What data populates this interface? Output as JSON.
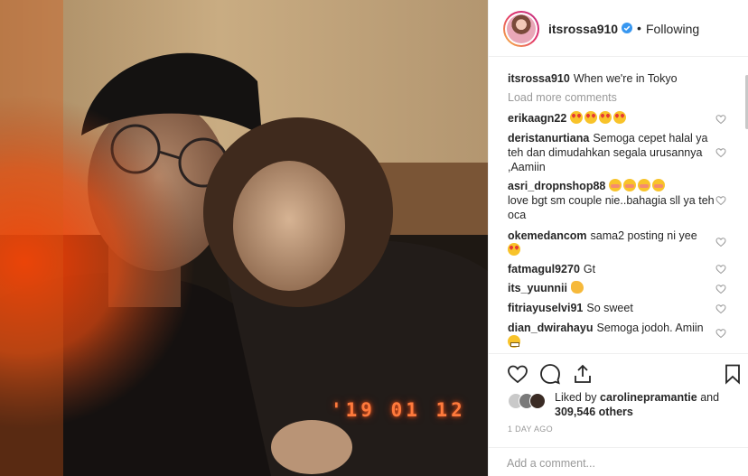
{
  "post": {
    "username": "itsrossa910",
    "follow_status": "Following",
    "separator": "•",
    "caption_user": "itsrossa910",
    "caption_text": "When we're in Tokyo",
    "photo_date_stamp": "'19 01 12"
  },
  "comments_panel": {
    "load_more_label": "Load more comments",
    "items": [
      {
        "user": "erikaagn22",
        "text": "",
        "emojis": [
          "heart-eyes",
          "heart-eyes",
          "heart-eyes",
          "heart-eyes"
        ]
      },
      {
        "user": "deristanurtiana",
        "text": "Semoga cepet halal ya teh dan dimudahkan segala urusannya ,Aamiin",
        "emojis": []
      },
      {
        "user": "asri_dropnshop88",
        "text": "love bgt sm couple nie..bahagia sll ya teh oca",
        "emojis": [
          "flushed",
          "flushed",
          "flushed",
          "flushed"
        ]
      },
      {
        "user": "okemedancom",
        "text": "sama2 posting ni yee",
        "emojis": [
          "heart-eyes"
        ]
      },
      {
        "user": "fatmagul9270",
        "text": "Gt",
        "emojis": []
      },
      {
        "user": "its_yuunnii",
        "text": "",
        "emojis": [
          "clap"
        ]
      },
      {
        "user": "fitriayuselvi91",
        "text": "So sweet",
        "emojis": []
      },
      {
        "user": "dian_dwirahayu",
        "text": "Semoga jodoh. Amiin",
        "emojis": [
          "grimace"
        ]
      }
    ]
  },
  "actions": {
    "like_icon": "heart-outline-icon",
    "comment_icon": "comment-bubble-icon",
    "share_icon": "share-upload-icon",
    "save_icon": "bookmark-icon"
  },
  "likes": {
    "prefix": "Liked by",
    "first_liker": "caroline pramantie",
    "first_liker_display": "carolinepramantie",
    "conjunction": "and",
    "others_count": "309,546 others"
  },
  "timestamp": "1 day ago",
  "add_comment": {
    "placeholder": "Add a comment..."
  },
  "colors": {
    "accent_blue": "#3897f0",
    "text_primary": "#262626",
    "text_secondary": "#999999",
    "border": "#efefef",
    "date_stamp": "#ff7a3c"
  }
}
